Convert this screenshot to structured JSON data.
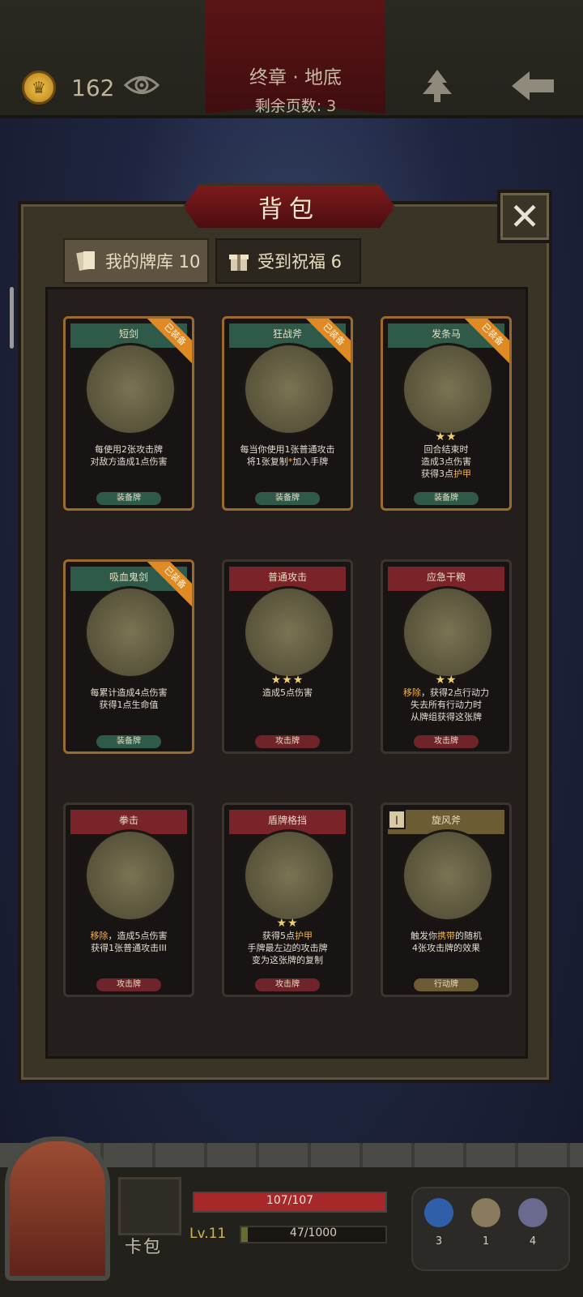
{
  "header": {
    "coins": "162",
    "chapter_title": "终章 · 地底",
    "pages_left": "剩余页数: 3"
  },
  "modal": {
    "title": "背包",
    "close_icon": "✕",
    "tabs": [
      {
        "label": "我的牌库 10",
        "active": true
      },
      {
        "label": "受到祝福 6",
        "active": false
      }
    ]
  },
  "cards": [
    {
      "name": "短剑",
      "badge": "已装备",
      "stars": "",
      "desc": "每使用2张攻击牌\n对敌方造成1点伤害",
      "type": "装备牌",
      "head_color": "#2f5a49",
      "type_color": "#2f5a49"
    },
    {
      "name": "狂战斧",
      "badge": "已装备",
      "stars": "",
      "desc": "每当你使用1张普通攻击\n将1张复制*加入手牌",
      "type": "装备牌",
      "head_color": "#2f5a49",
      "type_color": "#2f5a49"
    },
    {
      "name": "发条马",
      "badge": "已装备",
      "stars": "★★",
      "desc": "回合结束时\n造成3点伤害\n获得3点护甲",
      "type": "装备牌",
      "head_color": "#2f5a49",
      "type_color": "#2f5a49"
    },
    {
      "name": "吸血鬼剑",
      "badge": "已装备",
      "stars": "",
      "desc": "每累计造成4点伤害\n获得1点生命值",
      "type": "装备牌",
      "head_color": "#2f5a49",
      "type_color": "#2f5a49"
    },
    {
      "name": "普通攻击",
      "badge": "",
      "stars": "★★★",
      "desc": "造成5点伤害",
      "type": "攻击牌",
      "head_color": "#7a2429",
      "type_color": "#6e2429"
    },
    {
      "name": "应急干粮",
      "badge": "",
      "stars": "★★",
      "desc": "移除，获得2点行动力\n失去所有行动力时\n从牌组获得这张牌",
      "type": "攻击牌",
      "head_color": "#7a2429",
      "type_color": "#6e2429"
    },
    {
      "name": "拳击",
      "badge": "",
      "stars": "",
      "desc": "移除，造成5点伤害\n获得1张普通攻击III",
      "type": "攻击牌",
      "head_color": "#7a2429",
      "type_color": "#6e2429"
    },
    {
      "name": "盾牌格挡",
      "badge": "",
      "stars": "★★",
      "desc": "获得5点护甲\n手牌最左边的攻击牌\n变为这张牌的复制",
      "type": "攻击牌",
      "head_color": "#7a2429",
      "type_color": "#6e2429"
    },
    {
      "name": "旋风斧",
      "badge": "",
      "stars": "",
      "desc": "触发你携带的随机\n4张攻击牌的效果",
      "type": "行动牌",
      "head_color": "#6b5c34",
      "type_color": "#6b5c34",
      "tower": "I"
    }
  ],
  "bottom": {
    "bag_label": "卡包",
    "hp_text": "107/107",
    "hp_fraction": 1.0,
    "level": "Lv.11",
    "xp_text": "47/1000",
    "xp_fraction": 0.047,
    "inventory": [
      {
        "icon": "potion-icon",
        "count": "3",
        "color": "#2f5fa8"
      },
      {
        "icon": "hourglass-icon",
        "count": "1",
        "color": "#8a7b5e"
      },
      {
        "icon": "cards-icon",
        "count": "4",
        "color": "#6a6a8e"
      }
    ]
  }
}
